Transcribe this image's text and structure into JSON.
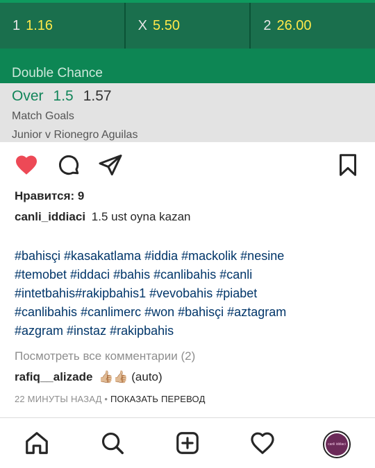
{
  "bet_image": {
    "odds": [
      {
        "selection": "1",
        "price": "1.16"
      },
      {
        "selection": "X",
        "price": "5.50"
      },
      {
        "selection": "2",
        "price": "26.00"
      }
    ],
    "section_label": "Double Chance",
    "bet": {
      "pick": "Over",
      "line": "1.5",
      "odds": "1.57"
    },
    "market": "Match Goals",
    "match": "Junior v Rionegro Aguilas"
  },
  "post": {
    "likes_text": "Нравится: 9",
    "caption_user": "canli_iddiaci",
    "caption_text": "1.5 ust oyna kazan",
    "hashtag_lines": [
      "#bahisçi  #kasakatlama  #iddia  #mackolik #nesine",
      "#temobet #iddaci #bahis #canlibahis  #canli",
      "#intetbahis#rakipbahis1 #vevobahis  #piabet",
      "#canlibahis  #canlimerc #won #bahisçi #aztagram",
      "#azgram #instaz #rakipbahis"
    ],
    "view_comments": "Посмотреть все комментарии (2)",
    "comment_user": "rafiq__alizade",
    "comment_text": "👍🏼👍🏼 (auto)",
    "time_ago": "22 МИНУТЫ НАЗАД",
    "separator": " • ",
    "translate_label": "ПОКАЗАТЬ ПЕРЕВОД"
  },
  "icons": {
    "like": "heart-icon",
    "comment": "comment-icon",
    "share": "send-icon",
    "save": "bookmark-icon",
    "home": "home-icon",
    "search": "search-icon",
    "add": "add-post-icon",
    "activity": "activity-heart-icon"
  },
  "colors": {
    "like_red": "#ed4956",
    "hashtag_blue": "#003569",
    "muted_gray": "#8e8e8e",
    "bet_green": "#146b48",
    "odds_yellow": "#ffe94a"
  },
  "profile": {
    "avatar_text": "canli iddiaci"
  }
}
